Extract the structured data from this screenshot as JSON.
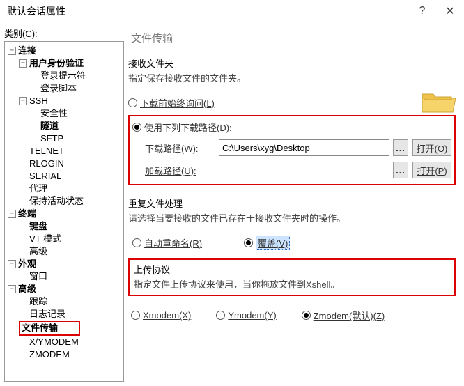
{
  "titlebar": {
    "title": "默认会话属性"
  },
  "sidebar": {
    "label": "类别(C):",
    "tree": {
      "connection": {
        "label": "连接",
        "user_identity": {
          "label": "用户身份验证",
          "login_prompt": "登录提示符",
          "login_script": "登录脚本"
        },
        "ssh": {
          "label": "SSH",
          "security": "安全性",
          "tunnel": "隧道",
          "sftp": "SFTP"
        },
        "telnet": "TELNET",
        "rlogin": "RLOGIN",
        "serial": "SERIAL",
        "proxy": "代理",
        "keepalive": "保持活动状态"
      },
      "terminal": {
        "label": "终端",
        "keyboard": "键盘",
        "vt": "VT 模式",
        "advanced": "高级"
      },
      "appearance": {
        "label": "外观",
        "window": "窗口"
      },
      "advanced": {
        "label": "高级",
        "trace": "跟踪",
        "logging": "日志记录",
        "file_transfer": "文件传输",
        "xymodem": "X/YMODEM",
        "zmodem": "ZMODEM"
      }
    }
  },
  "main": {
    "panel_title": "文件传输",
    "receive": {
      "title": "接收文件夹",
      "desc": "指定保存接收文件的文件夹。",
      "radio_ask": "下载前始终询问(L)",
      "radio_use_path": "使用下列下载路径(D):",
      "download_label": "下载路径(W):",
      "download_value": "C:\\Users\\xyg\\Desktop",
      "load_label": "加载路径(U):",
      "load_value": "",
      "open1": "打开(O)",
      "open2": "打开(P)"
    },
    "dup": {
      "title": "重复文件处理",
      "desc": "请选择当要接收的文件已存在于接收文件夹时的操作。",
      "auto": "自动重命名(R)",
      "overwrite": "覆盖(V)"
    },
    "upload": {
      "title": "上传协议",
      "desc": "指定文件上传协议来使用，当你拖放文件到Xshell。",
      "x": "Xmodem(X)",
      "y": "Ymodem(Y)",
      "z": "Zmodem(默认)(Z)"
    }
  }
}
